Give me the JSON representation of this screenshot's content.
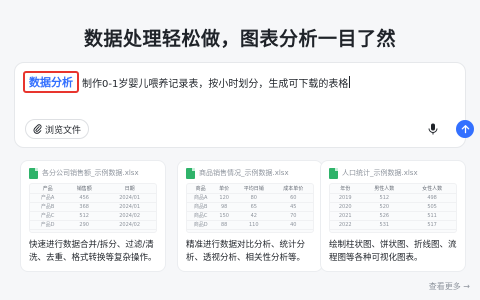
{
  "headline": "数据处理轻松做，图表分析一目了然",
  "prompt": {
    "tag": "数据分析",
    "text": "制作0-1岁婴儿喂养记录表，按小时划分，生成可下载的表格",
    "upload_label": "浏览文件",
    "icons": {
      "upload": "paperclip-icon",
      "mic": "microphone-icon",
      "send": "arrow-up-icon"
    },
    "colors": {
      "accent": "#3370ff",
      "tag_border": "#e8352e"
    }
  },
  "examples": [
    {
      "file_name": "各分公司销售额_示例数据.xlsx",
      "headers": [
        "产品",
        "销售额",
        "日期"
      ],
      "rows": [
        [
          "产品A",
          "456",
          "2024/01"
        ],
        [
          "产品B",
          "368",
          "2024/01"
        ],
        [
          "产品C",
          "512",
          "2024/02"
        ],
        [
          "产品D",
          "290",
          "2024/02"
        ]
      ],
      "desc": "快速进行数据合并/拆分、过滤/清洗、去重、格式转换等复杂操作。"
    },
    {
      "file_name": "商品销售情况_示例数据.xlsx",
      "headers": [
        "商品",
        "单价",
        "平均日销",
        "成本单价"
      ],
      "rows": [
        [
          "商品A",
          "120",
          "80",
          "60"
        ],
        [
          "商品B",
          "98",
          "65",
          "45"
        ],
        [
          "商品C",
          "150",
          "42",
          "70"
        ],
        [
          "商品D",
          "88",
          "110",
          "40"
        ]
      ],
      "desc": "精准进行数据对比分析、统计分析、透视分析、相关性分析等。"
    },
    {
      "file_name": "人口统计_示例数据.xlsx",
      "headers": [
        "年份",
        "男性人数",
        "女性人数"
      ],
      "rows": [
        [
          "2019",
          "512",
          "498"
        ],
        [
          "2020",
          "520",
          "505"
        ],
        [
          "2021",
          "526",
          "511"
        ],
        [
          "2022",
          "531",
          "517"
        ]
      ],
      "desc": "绘制柱状图、饼状图、折线图、流程图等各种可视化图表。"
    }
  ],
  "more_label": "查看更多 →"
}
